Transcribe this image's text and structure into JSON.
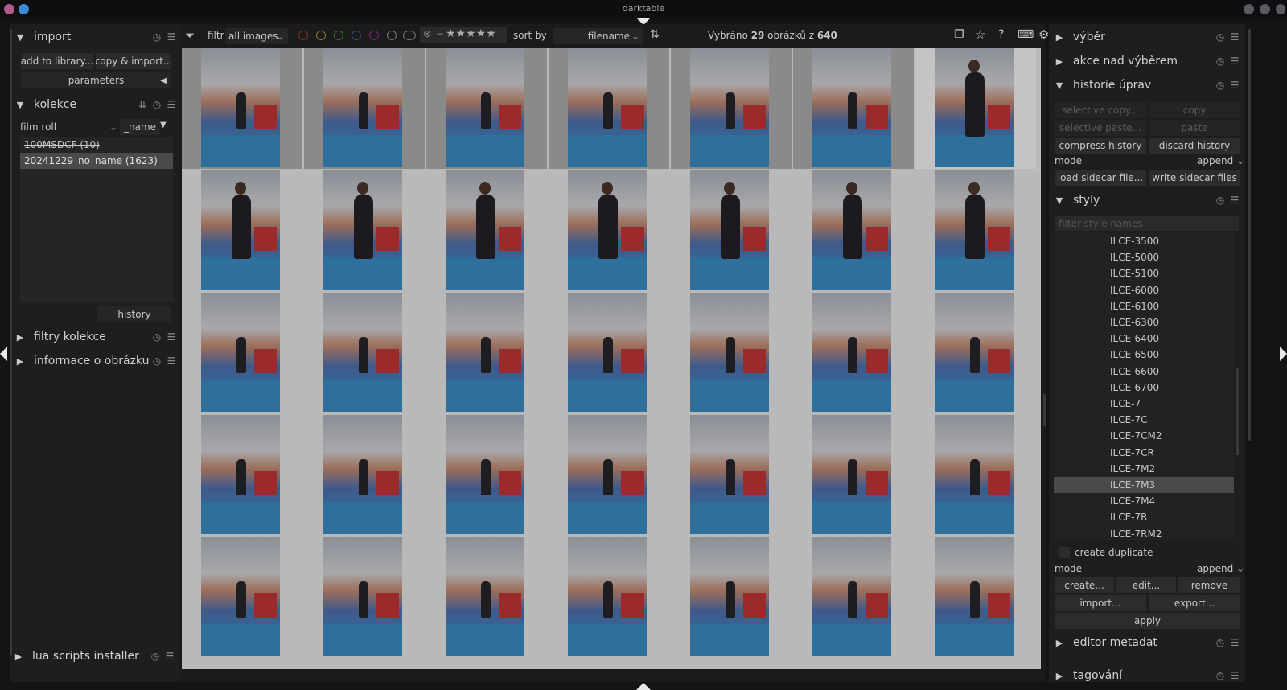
{
  "window": {
    "title": "darktable"
  },
  "left": {
    "import": {
      "title": "import",
      "btn_add": "add to library...",
      "btn_copy": "copy & import...",
      "btn_params": "parameters"
    },
    "kolekce": {
      "title": "kolekce",
      "property": "film roll",
      "sort": "_name",
      "rolls": [
        "100MSDCF (10)",
        "20241229_no_name (1623)"
      ],
      "history": "history"
    },
    "filtry": {
      "title": "filtry kolekce"
    },
    "informace": {
      "title": "informace o obrázku"
    },
    "lua": {
      "title": "lua scripts installer"
    }
  },
  "toolbar": {
    "filter_label": "filtr",
    "filter_value": "all images",
    "sort_label": "sort by",
    "sort_value": "filename",
    "sel_prefix": "Vybráno ",
    "sel_count": "29",
    "sel_mid": " obrázků z ",
    "sel_total": "640",
    "stars": "★★★★★"
  },
  "right": {
    "vyber": {
      "title": "výběr"
    },
    "akce": {
      "title": "akce nad výběrem"
    },
    "historie": {
      "title": "historie úprav",
      "sel_copy": "selective copy...",
      "copy": "copy",
      "sel_paste": "selective paste...",
      "paste": "paste",
      "compress": "compress history",
      "discard": "discard history",
      "mode_label": "mode",
      "mode_value": "append",
      "load": "load sidecar file...",
      "write": "write sidecar files"
    },
    "styly": {
      "title": "styly",
      "filter_placeholder": "filter style names",
      "items": [
        "ILCE-3500",
        "ILCE-5000",
        "ILCE-5100",
        "ILCE-6000",
        "ILCE-6100",
        "ILCE-6300",
        "ILCE-6400",
        "ILCE-6500",
        "ILCE-6600",
        "ILCE-6700",
        "ILCE-7",
        "ILCE-7C",
        "ILCE-7CM2",
        "ILCE-7CR",
        "ILCE-7M2",
        "ILCE-7M3",
        "ILCE-7M4",
        "ILCE-7R",
        "ILCE-7RM2"
      ],
      "selected": "ILCE-7M3",
      "dup": "create duplicate",
      "mode_label": "mode",
      "mode_value": "append",
      "create": "create...",
      "edit": "edit...",
      "remove": "remove",
      "import": "import...",
      "export": "export...",
      "apply": "apply"
    },
    "editor": {
      "title": "editor metadat"
    },
    "tagovani": {
      "title": "tagování"
    }
  },
  "colors": {
    "accent": "#e8e8e8",
    "panel": "#1e1e1e",
    "grid_bg": "#b9b9b9"
  }
}
